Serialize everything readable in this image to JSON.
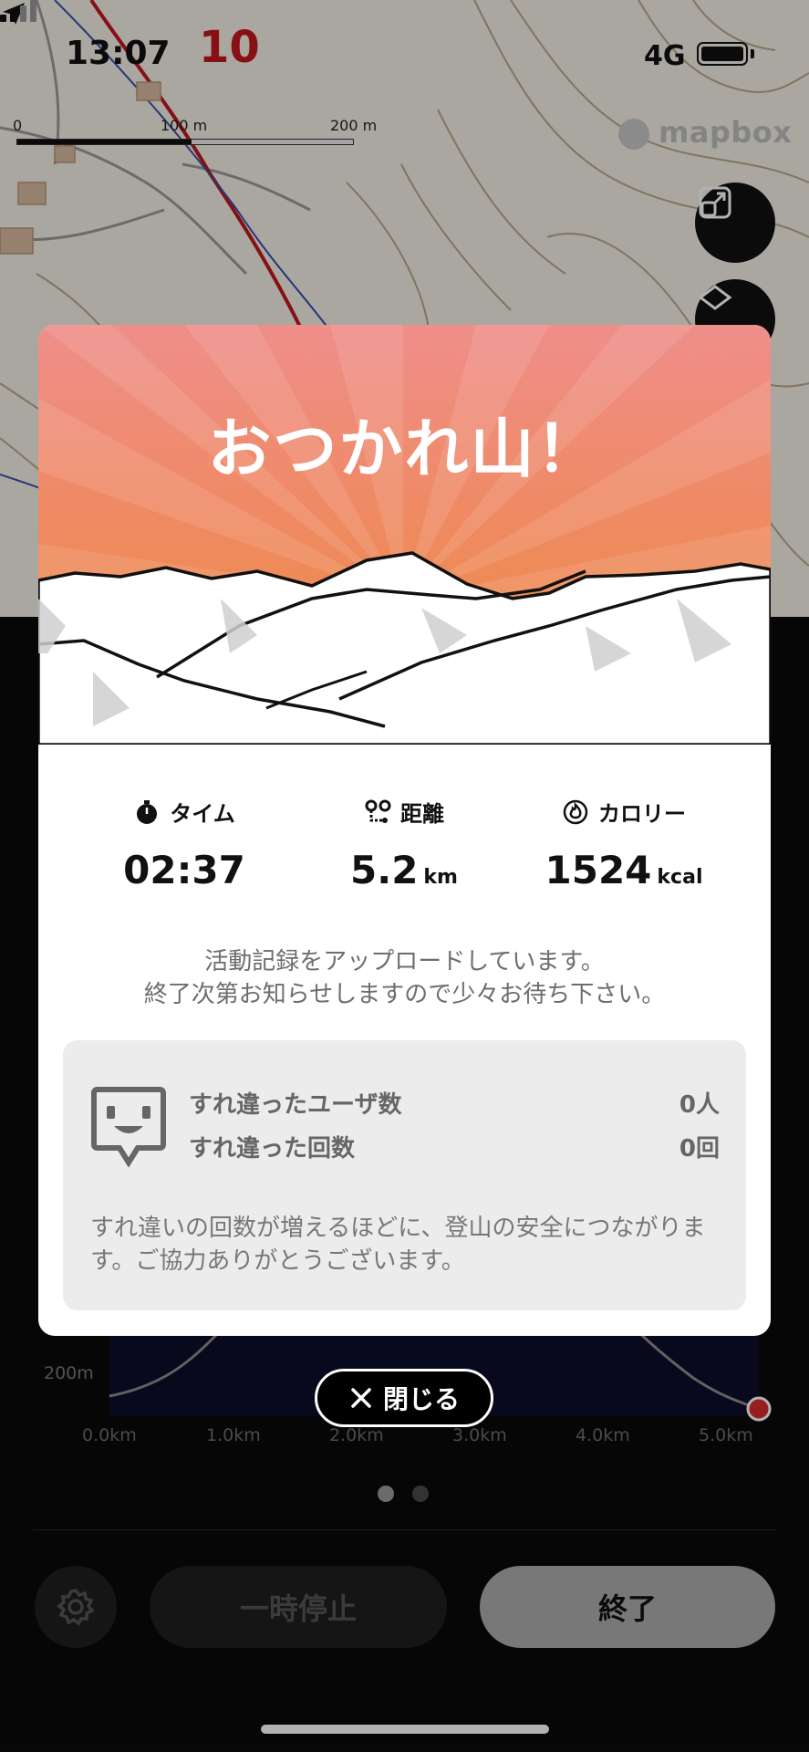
{
  "status_bar": {
    "time": "13:07",
    "badge": "10",
    "network": "4G"
  },
  "map": {
    "scale_labels": [
      "0",
      "100 m",
      "200 m"
    ],
    "attribution": "mapbox"
  },
  "modal": {
    "title": "おつかれ山！",
    "stats": [
      {
        "label": "タイム",
        "value": "02:37",
        "unit": "",
        "icon": "stopwatch-icon"
      },
      {
        "label": "距離",
        "value": "5.2",
        "unit": "km",
        "icon": "route-icon"
      },
      {
        "label": "カロリー",
        "value": "1524",
        "unit": "kcal",
        "icon": "flame-icon"
      }
    ],
    "upload_message": [
      "活動記録をアップロードしています。",
      "終了次第お知らせしますので少々お待ち下さい。"
    ],
    "encounter": {
      "users_label": "すれ違ったユーザ数",
      "users_value": "0人",
      "count_label": "すれ違った回数",
      "count_value": "0回",
      "note": "すれ違いの回数が増えるほどに、登山の安全につながります。ご協力ありがとうございます。"
    },
    "close_label": "閉じる"
  },
  "elevation_chart": {
    "y_label": "200m",
    "x_labels": [
      "0.0km",
      "1.0km",
      "2.0km",
      "3.0km",
      "4.0km",
      "5.0km"
    ]
  },
  "controls": {
    "pause_label": "一時停止",
    "end_label": "終了"
  },
  "colors": {
    "banner_top": "#ef8e8a",
    "banner_bottom": "#ee8a3c",
    "badge": "#c0171e",
    "end_button": "#adadad",
    "track_end_marker": "#d92b2b"
  }
}
